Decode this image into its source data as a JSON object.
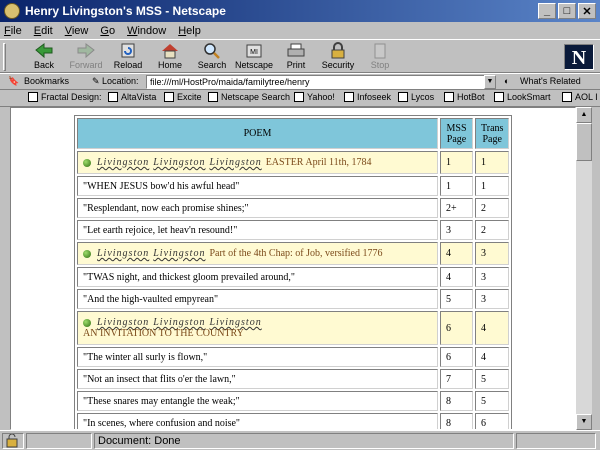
{
  "window": {
    "title": "Henry Livingston's MSS - Netscape"
  },
  "menu": [
    "File",
    "Edit",
    "View",
    "Go",
    "Window",
    "Help"
  ],
  "toolbar": [
    {
      "label": "Back",
      "icon": "back-arrow-icon",
      "enabled": true
    },
    {
      "label": "Forward",
      "icon": "forward-arrow-icon",
      "enabled": false
    },
    {
      "label": "Reload",
      "icon": "reload-icon",
      "enabled": true
    },
    {
      "label": "Home",
      "icon": "home-icon",
      "enabled": true
    },
    {
      "label": "Search",
      "icon": "search-icon",
      "enabled": true
    },
    {
      "label": "Netscape",
      "icon": "netscape-icon",
      "enabled": true
    },
    {
      "label": "Print",
      "icon": "print-icon",
      "enabled": true
    },
    {
      "label": "Security",
      "icon": "lock-icon",
      "enabled": true
    },
    {
      "label": "Stop",
      "icon": "stop-icon",
      "enabled": false
    }
  ],
  "location": {
    "bookmarks_label": "Bookmarks",
    "location_label": "Location:",
    "url": "file:///ml/HostPro/maida/familytree/henry",
    "whats_related": "What's Related"
  },
  "personal_bar": [
    "Fractal Design:",
    "AltaVista",
    "Excite",
    "Netscape Search",
    "Yahoo!",
    "Infoseek",
    "Lycos",
    "HotBot",
    "LookSmart",
    "AOL I"
  ],
  "table": {
    "headers": {
      "poem": "POEM",
      "mss": "MSS Page",
      "trans": "Trans Page"
    },
    "rows": [
      {
        "type": "heading",
        "sigs": [
          "Livingston",
          "Livingston",
          "Livingston"
        ],
        "text": "EASTER April 11th, 1784",
        "mss": "1",
        "trans": "1"
      },
      {
        "type": "line",
        "text": "\"WHEN JESUS bow'd his awful head\"",
        "mss": "1",
        "trans": "1"
      },
      {
        "type": "line",
        "text": "\"Resplendant, now each promise shines;\"",
        "mss": "2+",
        "trans": "2"
      },
      {
        "type": "line",
        "text": "\"Let earth rejoice, let heav'n resound!\"",
        "mss": "3",
        "trans": "2"
      },
      {
        "type": "heading",
        "sigs": [
          "Livingston",
          "Livingston"
        ],
        "text": "Part of the 4th Chap: of Job, versified 1776",
        "mss": "4",
        "trans": "3"
      },
      {
        "type": "line",
        "text": "\"TWAS night, and thickest gloom prevailed around,\"",
        "mss": "4",
        "trans": "3"
      },
      {
        "type": "line",
        "text": "\"And the high-vaulted empyrean\"",
        "mss": "5",
        "trans": "3"
      },
      {
        "type": "heading2",
        "sigs": [
          "Livingston",
          "Livingston",
          "Livingston"
        ],
        "text": "AN INVITATION TO THE COUNTRY",
        "mss": "6",
        "trans": "4"
      },
      {
        "type": "line",
        "text": "\"The winter all surly is flown,\"",
        "mss": "6",
        "trans": "4"
      },
      {
        "type": "line",
        "text": "\"Not an insect that flits o'er the lawn,\"",
        "mss": "7",
        "trans": "5"
      },
      {
        "type": "line",
        "text": "\"These snares may entangle the weak;\"",
        "mss": "8",
        "trans": "5"
      },
      {
        "type": "line",
        "text": "\"In scenes, where confusion and noise\"",
        "mss": "8",
        "trans": "6"
      }
    ]
  },
  "status": {
    "text": "Document: Done"
  }
}
